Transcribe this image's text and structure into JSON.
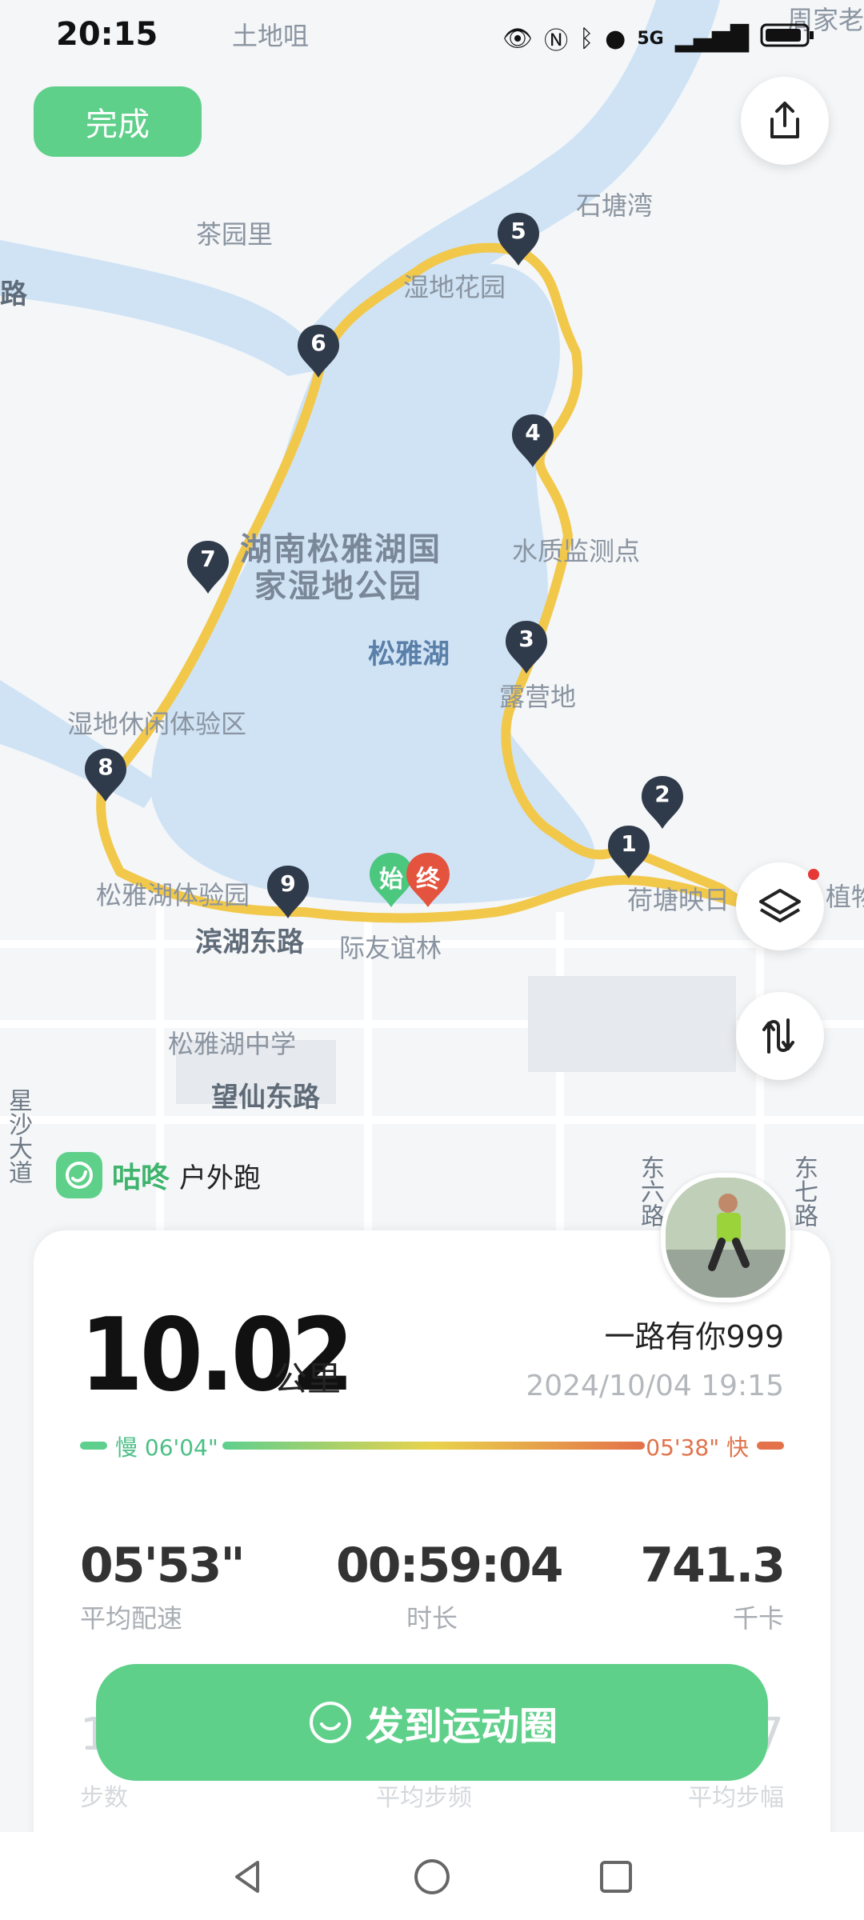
{
  "status_bar": {
    "time": "20:15",
    "network": "5G"
  },
  "top": {
    "done_label": "完成",
    "share_icon": "share-icon"
  },
  "map_labels": {
    "tudizui": "土地咀",
    "shitangwan": "石塘湾",
    "chayuanli": "茶园里",
    "shidihuayuan": "湿地花园",
    "park_line1": "湖南松雅湖国",
    "park_line2": "家湿地公园",
    "shuizhi": "水质监测点",
    "songyahu": "松雅湖",
    "luyingdi": "露营地",
    "xiuxian": "湿地休闲体验区",
    "tiyanyuan": "松雅湖体验园",
    "binhu": "滨湖东路",
    "youyilin": "际友谊林",
    "hetang": "荷塘映日",
    "zhongxue": "松雅湖中学",
    "wangxian": "望仙东路",
    "lu_left": "路",
    "dongliu": "东六路",
    "dongqi": "东七路",
    "zhoujia": "周家老",
    "zhi": "植物",
    "xing": "星沙大道"
  },
  "markers": [
    "1",
    "2",
    "3",
    "4",
    "5",
    "6",
    "7",
    "8",
    "9"
  ],
  "start_label": "始",
  "end_label": "终",
  "brand": {
    "name": "咕咚",
    "activity": "户外跑"
  },
  "summary": {
    "distance": "10.02",
    "distance_unit": "公里",
    "username": "一路有你999",
    "datetime": "2024/10/04 19:15",
    "pace_slow": "慢 06'04\"",
    "pace_fast": "05'38\" 快"
  },
  "stats": [
    {
      "value": "05'53\"",
      "label": "平均配速"
    },
    {
      "value": "00:59:04",
      "label": "时长"
    },
    {
      "value": "741.3",
      "label": "千卡"
    }
  ],
  "stats_second_row": [
    {
      "value": "1",
      "label": "步数"
    },
    {
      "value": "",
      "label": "平均步频"
    },
    {
      "value": "7",
      "label": "平均步幅"
    }
  ],
  "share_button": "发到运动圈",
  "colors": {
    "accent": "#5fd08a",
    "route": "#f2c84b",
    "marker": "#2f3a4a",
    "start": "#4cc77e",
    "end": "#e4533d"
  }
}
